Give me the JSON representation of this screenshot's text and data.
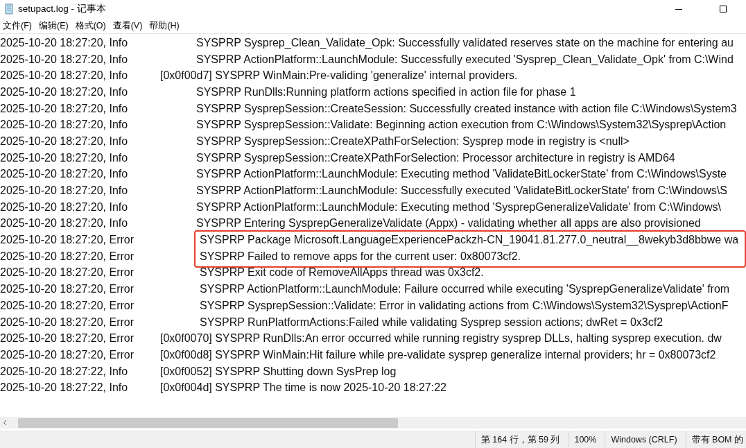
{
  "window": {
    "title": "setupact.log - 记事本"
  },
  "menu": [
    "文件(F)",
    "编辑(E)",
    "格式(O)",
    "查看(V)",
    "帮助(H)"
  ],
  "lines": [
    {
      "stamp": "2025-10-20 18:27:20, Info",
      "kind": "plain",
      "highlighted": false,
      "message": "SYSPRP Sysprep_Clean_Validate_Opk: Successfully validated reserves state on the machine for entering au"
    },
    {
      "stamp": "2025-10-20 18:27:20, Info",
      "kind": "plain",
      "highlighted": false,
      "message": "SYSPRP ActionPlatform::LaunchModule: Successfully executed 'Sysprep_Clean_Validate_Opk' from C:\\Wind"
    },
    {
      "stamp": "2025-10-20 18:27:20, Info",
      "kind": "tagged",
      "highlighted": false,
      "message": "[0x0f00d7] SYSPRP WinMain:Pre-validing 'generalize' internal providers."
    },
    {
      "stamp": "2025-10-20 18:27:20, Info",
      "kind": "plain",
      "highlighted": false,
      "message": "SYSPRP RunDlls:Running platform actions specified in action file for phase 1"
    },
    {
      "stamp": "2025-10-20 18:27:20, Info",
      "kind": "plain",
      "highlighted": false,
      "message": "SYSPRP SysprepSession::CreateSession: Successfully created instance with action file C:\\Windows\\System3"
    },
    {
      "stamp": "2025-10-20 18:27:20, Info",
      "kind": "plain",
      "highlighted": false,
      "message": "SYSPRP SysprepSession::Validate: Beginning action execution from C:\\Windows\\System32\\Sysprep\\Action"
    },
    {
      "stamp": "2025-10-20 18:27:20, Info",
      "kind": "plain",
      "highlighted": false,
      "message": "SYSPRP SysprepSession::CreateXPathForSelection: Sysprep mode in registry is <null>"
    },
    {
      "stamp": "2025-10-20 18:27:20, Info",
      "kind": "plain",
      "highlighted": false,
      "message": "SYSPRP SysprepSession::CreateXPathForSelection: Processor architecture in registry is AMD64"
    },
    {
      "stamp": "2025-10-20 18:27:20, Info",
      "kind": "plain",
      "highlighted": false,
      "message": "SYSPRP ActionPlatform::LaunchModule: Executing method 'ValidateBitLockerState' from C:\\Windows\\Syste"
    },
    {
      "stamp": "2025-10-20 18:27:20, Info",
      "kind": "plain",
      "highlighted": false,
      "message": "SYSPRP ActionPlatform::LaunchModule: Successfully executed 'ValidateBitLockerState' from C:\\Windows\\S"
    },
    {
      "stamp": "2025-10-20 18:27:20, Info",
      "kind": "plain",
      "highlighted": false,
      "message": "SYSPRP ActionPlatform::LaunchModule: Executing method 'SysprepGeneralizeValidate' from C:\\Windows\\"
    },
    {
      "stamp": "2025-10-20 18:27:20, Info",
      "kind": "plain",
      "highlighted": false,
      "message": "SYSPRP Entering SysprepGeneralizeValidate (Appx) - validating whether all apps are also provisioned"
    },
    {
      "stamp": "2025-10-20 18:27:20, Error",
      "kind": "plain",
      "highlighted": true,
      "message": "SYSPRP Package Microsoft.LanguageExperiencePackzh-CN_19041.81.277.0_neutral__8wekyb3d8bbwe wa"
    },
    {
      "stamp": "2025-10-20 18:27:20, Error",
      "kind": "plain",
      "highlighted": true,
      "message": "SYSPRP Failed to remove apps for the current user: 0x80073cf2."
    },
    {
      "stamp": "2025-10-20 18:27:20, Error",
      "kind": "plain",
      "highlighted": false,
      "message": "SYSPRP Exit code of RemoveAllApps thread was 0x3cf2."
    },
    {
      "stamp": "2025-10-20 18:27:20, Error",
      "kind": "plain",
      "highlighted": false,
      "message": "SYSPRP ActionPlatform::LaunchModule: Failure occurred while executing 'SysprepGeneralizeValidate' from"
    },
    {
      "stamp": "2025-10-20 18:27:20, Error",
      "kind": "plain",
      "highlighted": false,
      "message": "SYSPRP SysprepSession::Validate: Error in validating actions from C:\\Windows\\System32\\Sysprep\\ActionF"
    },
    {
      "stamp": "2025-10-20 18:27:20, Error",
      "kind": "plain",
      "highlighted": false,
      "message": "SYSPRP RunPlatformActions:Failed while validating Sysprep session actions; dwRet = 0x3cf2"
    },
    {
      "stamp": "2025-10-20 18:27:20, Error",
      "kind": "tagged",
      "highlighted": false,
      "message": "[0x0f0070] SYSPRP RunDlls:An error occurred while running registry sysprep DLLs, halting sysprep execution. dw"
    },
    {
      "stamp": "2025-10-20 18:27:20, Error",
      "kind": "tagged",
      "highlighted": false,
      "message": "[0x0f00d8] SYSPRP WinMain:Hit failure while pre-validate sysprep generalize internal providers; hr = 0x80073cf2"
    },
    {
      "stamp": "2025-10-20 18:27:22, Info",
      "kind": "tagged",
      "highlighted": false,
      "message": "[0x0f0052] SYSPRP Shutting down SysPrep log"
    },
    {
      "stamp": "2025-10-20 18:27:22, Info",
      "kind": "tagged",
      "highlighted": false,
      "message": "[0x0f004d] SYSPRP The time is now 2025-10-20 18:27:22"
    }
  ],
  "status_bar": [
    "第 164 行，第 59 列",
    "100%",
    "Windows (CRLF)",
    "带有 BOM 的"
  ]
}
